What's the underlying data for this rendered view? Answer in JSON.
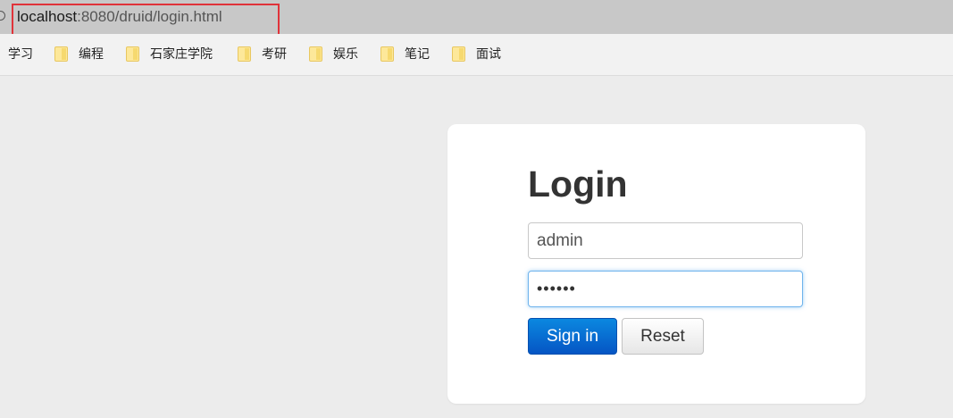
{
  "browser": {
    "url_host": "localhost",
    "url_rest": ":8080/druid/login.html"
  },
  "bookmarks": [
    {
      "label": "学习"
    },
    {
      "label": "编程"
    },
    {
      "label": "石家庄学院"
    },
    {
      "label": "考研"
    },
    {
      "label": "娱乐"
    },
    {
      "label": "笔记"
    },
    {
      "label": "面试"
    }
  ],
  "login": {
    "title": "Login",
    "username_value": "admin",
    "password_value": "••••••",
    "signin_label": "Sign in",
    "reset_label": "Reset"
  },
  "colors": {
    "highlight": "#e0333a",
    "primary_button": "#0b6fd6"
  }
}
